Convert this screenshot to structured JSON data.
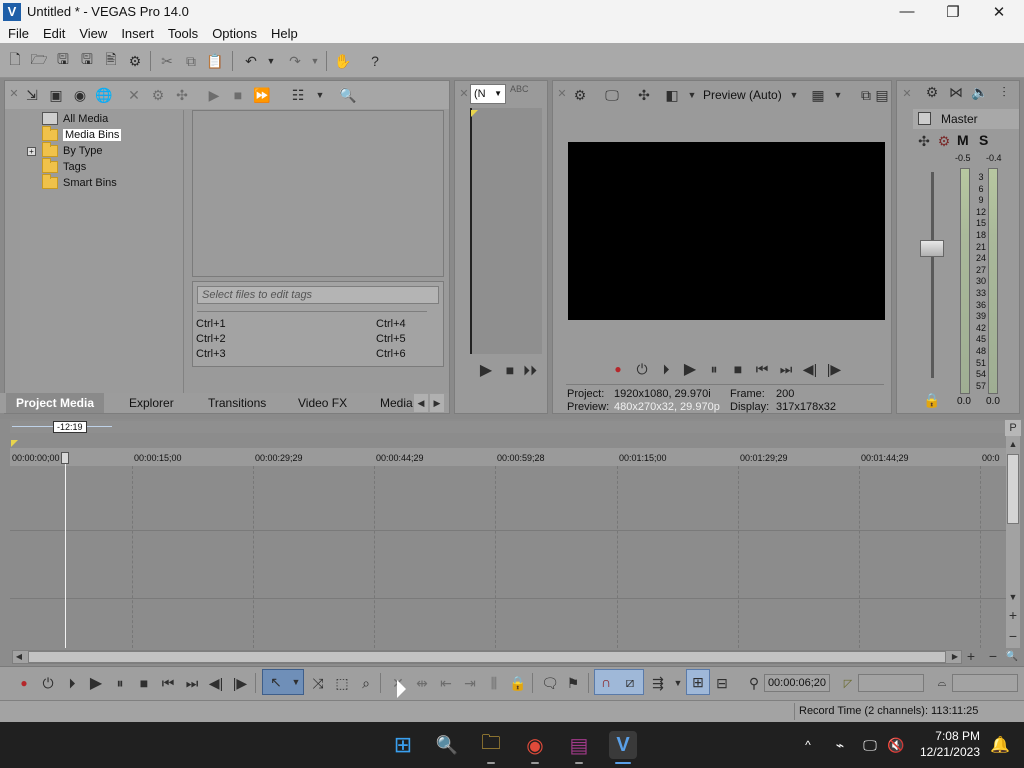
{
  "window": {
    "title": "Untitled * - VEGAS Pro 14.0",
    "logo_glyph": "V",
    "minimize": "—",
    "maximize": "❐",
    "close": "✕"
  },
  "menu": [
    "File",
    "Edit",
    "View",
    "Insert",
    "Tools",
    "Options",
    "Help"
  ],
  "project_media": {
    "tree": [
      {
        "label": "All Media",
        "icon": "all-media-icon"
      },
      {
        "label": "Media Bins",
        "icon": "folder-icon",
        "selected": true
      },
      {
        "label": "By Type",
        "icon": "folder-icon",
        "expander": "+"
      },
      {
        "label": "Tags",
        "icon": "folder-icon"
      },
      {
        "label": "Smart Bins",
        "icon": "folder-icon"
      }
    ],
    "tags_placeholder": "Select files to edit tags",
    "hotkeys_left": [
      "Ctrl+1",
      "Ctrl+2",
      "Ctrl+3"
    ],
    "hotkeys_right": [
      "Ctrl+4",
      "Ctrl+5",
      "Ctrl+6"
    ]
  },
  "tabs": [
    "Project Media",
    "Explorer",
    "Transitions",
    "Video FX",
    "Media"
  ],
  "trimmer": {
    "dropdown_value": "(N",
    "abc_label": "ABC"
  },
  "preview": {
    "quality": "Preview (Auto)",
    "project_label": "Project:",
    "project_value": "1920x1080, 29.970i",
    "frame_label": "Frame:",
    "frame_value": "200",
    "preview_label": "Preview:",
    "preview_value": "480x270x32, 29.970p",
    "display_label": "Display:",
    "display_value": "317x178x32"
  },
  "mixer": {
    "title": "Master",
    "m_label": "M",
    "s_label": "S",
    "peak_left": "-0.5",
    "peak_right": "-0.4",
    "scale": [
      "3",
      "6",
      "9",
      "12",
      "15",
      "18",
      "21",
      "24",
      "27",
      "30",
      "33",
      "36",
      "39",
      "42",
      "45",
      "48",
      "51",
      "54",
      "57"
    ],
    "level_left": "0.0",
    "level_right": "0.0",
    "fader_level": "0.0"
  },
  "timeline": {
    "region_label": "-12:19",
    "ruler": [
      "00:00:00;00",
      "00:00:15;00",
      "00:00:29;29",
      "00:00:44;29",
      "00:00:59;28",
      "00:01:15;00",
      "00:01:29;29",
      "00:01:44;29",
      "00:0"
    ],
    "cursor_time": "00:00:06;20"
  },
  "status": {
    "record_time": "Record Time (2 channels): 113:11:25"
  },
  "taskbar": {
    "time": "7:08 PM",
    "date": "12/21/2023"
  },
  "colors": {
    "accent": "#1f5fa8",
    "panel": "#9a9a9a",
    "taskbar": "#202020"
  }
}
